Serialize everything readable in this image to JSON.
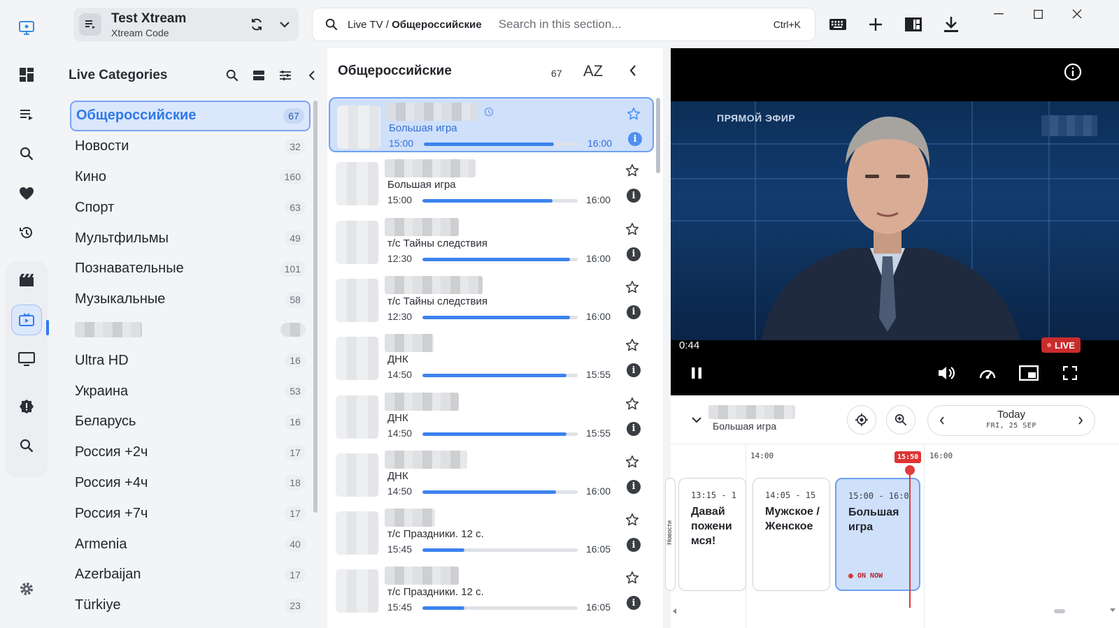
{
  "source": {
    "title": "Test Xtream",
    "subtitle": "Xtream Code"
  },
  "search": {
    "breadcrumb_prefix": "Live TV / ",
    "breadcrumb_current": "Общероссийские",
    "placeholder": "Search in this section...",
    "shortcut": "Ctrl+K"
  },
  "rail": {
    "icons": [
      "dashboard-icon",
      "playlists-icon",
      "search-icon",
      "favorites-icon",
      "history-icon",
      "movies-icon",
      "live-tv-icon",
      "tv-icon",
      "alert-icon",
      "search-icon",
      "settings-icon"
    ]
  },
  "categories": {
    "title": "Live Categories",
    "items": [
      {
        "label": "Общероссийские",
        "count": "67",
        "active": true
      },
      {
        "label": "Новости",
        "count": "32"
      },
      {
        "label": "Кино",
        "count": "160"
      },
      {
        "label": "Спорт",
        "count": "63"
      },
      {
        "label": "Мультфильмы",
        "count": "49"
      },
      {
        "label": "Познавательные",
        "count": "101"
      },
      {
        "label": "Музыкальные",
        "count": "58"
      },
      {
        "label": "",
        "count": "",
        "blurred": true
      },
      {
        "label": "Ultra HD",
        "count": "16"
      },
      {
        "label": "Украина",
        "count": "53"
      },
      {
        "label": "Беларусь",
        "count": "16"
      },
      {
        "label": "Россия +2ч",
        "count": "17"
      },
      {
        "label": "Россия +4ч",
        "count": "18"
      },
      {
        "label": "Россия +7ч",
        "count": "17"
      },
      {
        "label": "Armenia",
        "count": "40"
      },
      {
        "label": "Azerbaijan",
        "count": "17"
      },
      {
        "label": "Türkiye",
        "count": "23"
      }
    ]
  },
  "channels": {
    "title": "Общероссийские",
    "count": "67",
    "sort_label": "AZ",
    "items": [
      {
        "program": "Большая игра",
        "start": "15:00",
        "end": "16:00",
        "progress": 0.84,
        "active": true
      },
      {
        "program": "Большая игра",
        "start": "15:00",
        "end": "16:00",
        "progress": 0.84
      },
      {
        "program": "т/с Тайны следствия",
        "start": "12:30",
        "end": "16:00",
        "progress": 0.95
      },
      {
        "program": "т/с Тайны следствия",
        "start": "12:30",
        "end": "16:00",
        "progress": 0.95
      },
      {
        "program": "ДНК",
        "start": "14:50",
        "end": "15:55",
        "progress": 0.93
      },
      {
        "program": "ДНК",
        "start": "14:50",
        "end": "15:55",
        "progress": 0.93
      },
      {
        "program": "ДНК",
        "start": "14:50",
        "end": "16:00",
        "progress": 0.86
      },
      {
        "program": "т/с Праздники. 12 с.",
        "start": "15:45",
        "end": "16:05",
        "progress": 0.27
      },
      {
        "program": "т/с Праздники. 12 с.",
        "start": "15:45",
        "end": "16:05",
        "progress": 0.27
      }
    ]
  },
  "player": {
    "overlay_text": "ПРЯМОЙ ЭФИР",
    "elapsed": "0:44",
    "live_label": "LIVE"
  },
  "epg": {
    "channel_program": "Большая игра",
    "date_main": "Today",
    "date_sub": "FRI, 25 SEP",
    "ticks": [
      "14:00",
      "16:00"
    ],
    "now_time": "15:50",
    "partial_program": "Новости",
    "programs": [
      {
        "time": "13:15 - 1",
        "name": "Давай пожени мся!"
      },
      {
        "time": "14:05 - 15",
        "name": "Мужское / Женское"
      },
      {
        "time": "15:00 - 16:0",
        "name": "Большая игра",
        "on_now": true
      }
    ],
    "on_now_label": "ON NOW"
  },
  "colors": {
    "accent": "#3c82ef",
    "live": "#c92c2c",
    "now_line": "#e23b3b"
  }
}
